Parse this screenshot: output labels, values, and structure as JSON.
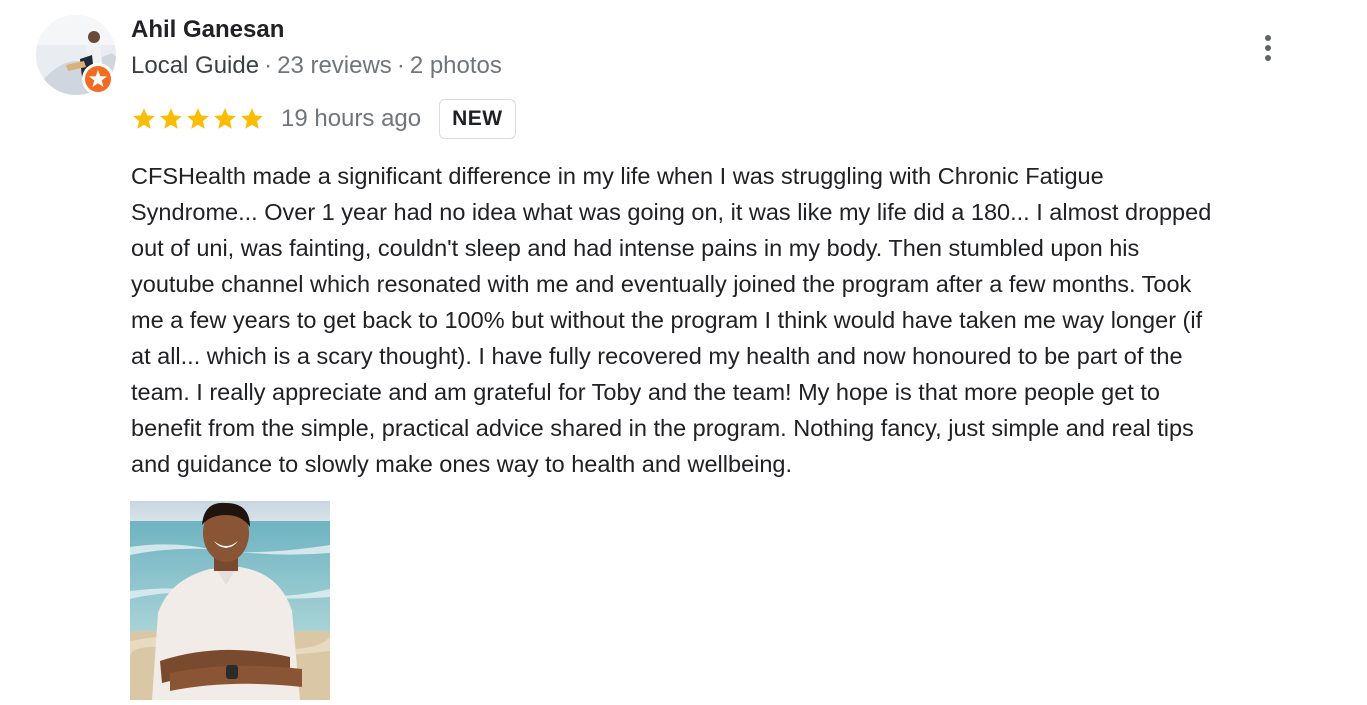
{
  "review": {
    "author": {
      "name": "Ahil Ganesan",
      "level": "Local Guide",
      "reviews_count": "23 reviews",
      "photos_count": "2 photos",
      "separator": "·"
    },
    "rating": {
      "stars": 5,
      "max_stars": 5,
      "star_color": "#fbbc04",
      "time_ago": "19 hours ago",
      "badge": "NEW"
    },
    "body_lines": [
      "CFSHealth made a significant difference in my life when I was struggling with Chronic Fatigue",
      "Syndrome... Over 1 year had no idea what was going on, it was like my life did a 180... I almost dropped",
      "out of uni, was fainting, couldn't sleep and had intense pains in my body. Then stumbled upon his",
      "youtube channel which resonated with me and eventually joined the program after a few months. Took",
      "me a few years to get back to 100% but without the program I think would have taken me way longer (if",
      "at all... which is a scary thought). I have fully recovered my health and now honoured to be part of the",
      "team. I really appreciate and am grateful for Toby and the team! My hope is that more people get to",
      "benefit from the simple, practical advice shared in the program. Nothing fancy, just simple and real tips",
      "and guidance to slowly make ones way to health and wellbeing."
    ],
    "icons": {
      "menu": "more-vert-icon",
      "badge": "local-guide-badge-icon",
      "star": "star-icon"
    },
    "colors": {
      "guide_badge": "#f36b21",
      "meta_text": "#70757a",
      "text": "#202124"
    }
  }
}
